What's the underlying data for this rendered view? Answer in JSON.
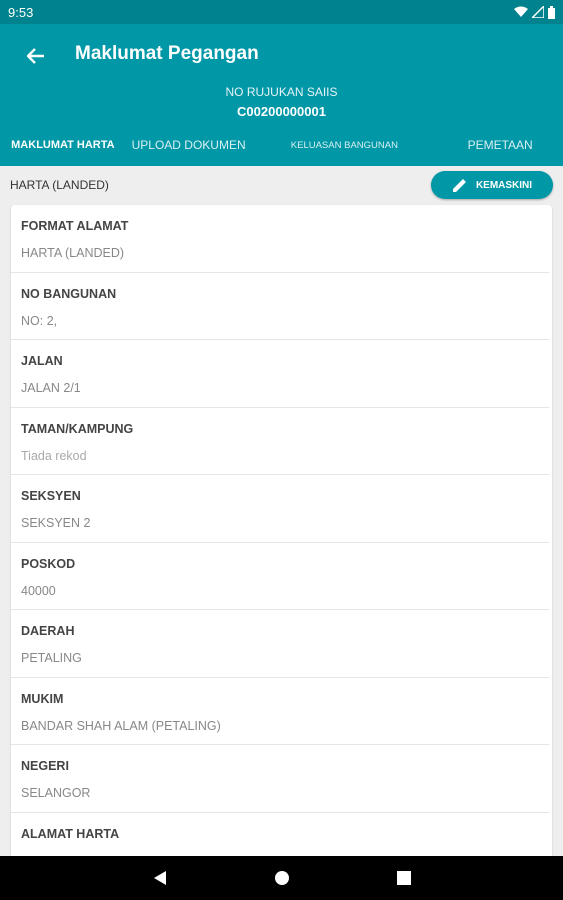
{
  "status_bar": {
    "time": "9:53"
  },
  "app_bar": {
    "title": "Maklumat Pegangan",
    "ref_label": "NO RUJUKAN SAIIS",
    "ref_value": "C00200000001"
  },
  "tabs": [
    {
      "label": "MAKLUMAT HARTA",
      "active": true
    },
    {
      "label": "UPLOAD DOKUMEN",
      "active": false
    },
    {
      "label": "KELUASAN BANGUNAN",
      "active": false
    },
    {
      "label": "PEMETAAN",
      "active": false
    }
  ],
  "section": {
    "title": "HARTA (LANDED)",
    "edit_label": "KEMASKINI"
  },
  "fields": [
    {
      "label": "FORMAT ALAMAT",
      "value": "HARTA (LANDED)"
    },
    {
      "label": "NO BANGUNAN",
      "value": "NO: 2,"
    },
    {
      "label": "JALAN",
      "value": "JALAN 2/1"
    },
    {
      "label": "TAMAN/KAMPUNG",
      "value": "Tiada rekod"
    },
    {
      "label": "SEKSYEN",
      "value": "SEKSYEN 2"
    },
    {
      "label": "POSKOD",
      "value": "40000"
    },
    {
      "label": "DAERAH",
      "value": "PETALING"
    },
    {
      "label": "MUKIM",
      "value": "BANDAR SHAH ALAM (PETALING)"
    },
    {
      "label": "NEGERI",
      "value": "SELANGOR"
    },
    {
      "label": "ALAMAT HARTA",
      "value": ""
    }
  ],
  "colors": {
    "primary": "#0097a7",
    "status_bar": "#00838f",
    "background": "#eeeeee"
  }
}
